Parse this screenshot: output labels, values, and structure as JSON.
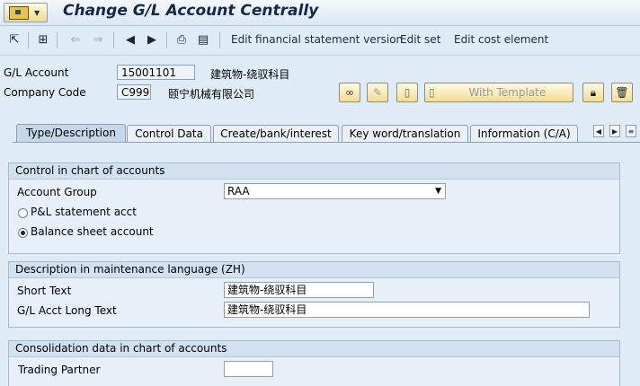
{
  "window": {
    "title": "Change G/L Account Centrally"
  },
  "toolbar": {
    "icons": [
      "navigation-icon",
      "hierarchy-icon",
      "previous-object-icon",
      "next-object-icon",
      "first-page-icon",
      "prev-page-icon",
      "next-page-icon",
      "print-icon",
      "notes-icon"
    ],
    "links": [
      {
        "label": "Edit financial statement version"
      },
      {
        "label": "Edit set"
      },
      {
        "label": "Edit cost element"
      }
    ]
  },
  "header": {
    "gl_account_label": "G/L Account",
    "gl_account_value": "15001101",
    "gl_account_desc": "建筑物-绕驭科目",
    "company_code_label": "Company Code",
    "company_code_value": "C999",
    "company_code_desc": "颐宁机械有限公司",
    "with_template_label": "With Template"
  },
  "tabs": [
    {
      "label": "Type/Description",
      "active": true
    },
    {
      "label": "Control Data"
    },
    {
      "label": "Create/bank/interest"
    },
    {
      "label": "Key word/translation"
    },
    {
      "label": "Information (C/A)"
    }
  ],
  "control": {
    "title": "Control in chart of accounts",
    "account_group_label": "Account Group",
    "account_group_value": "RAA",
    "pl_label": "P&L statement acct",
    "bs_label": "Balance sheet account",
    "selected": "balance_sheet"
  },
  "description": {
    "title": "Description in maintenance language (ZH)",
    "short_text_label": "Short Text",
    "short_text_value": "建筑物-绕驭科目",
    "long_text_label": "G/L Acct Long Text",
    "long_text_value": "建筑物-绕驭科目"
  },
  "consolidation": {
    "title": "Consolidation data in chart of accounts",
    "trading_partner_label": "Trading Partner",
    "trading_partner_value": ""
  }
}
